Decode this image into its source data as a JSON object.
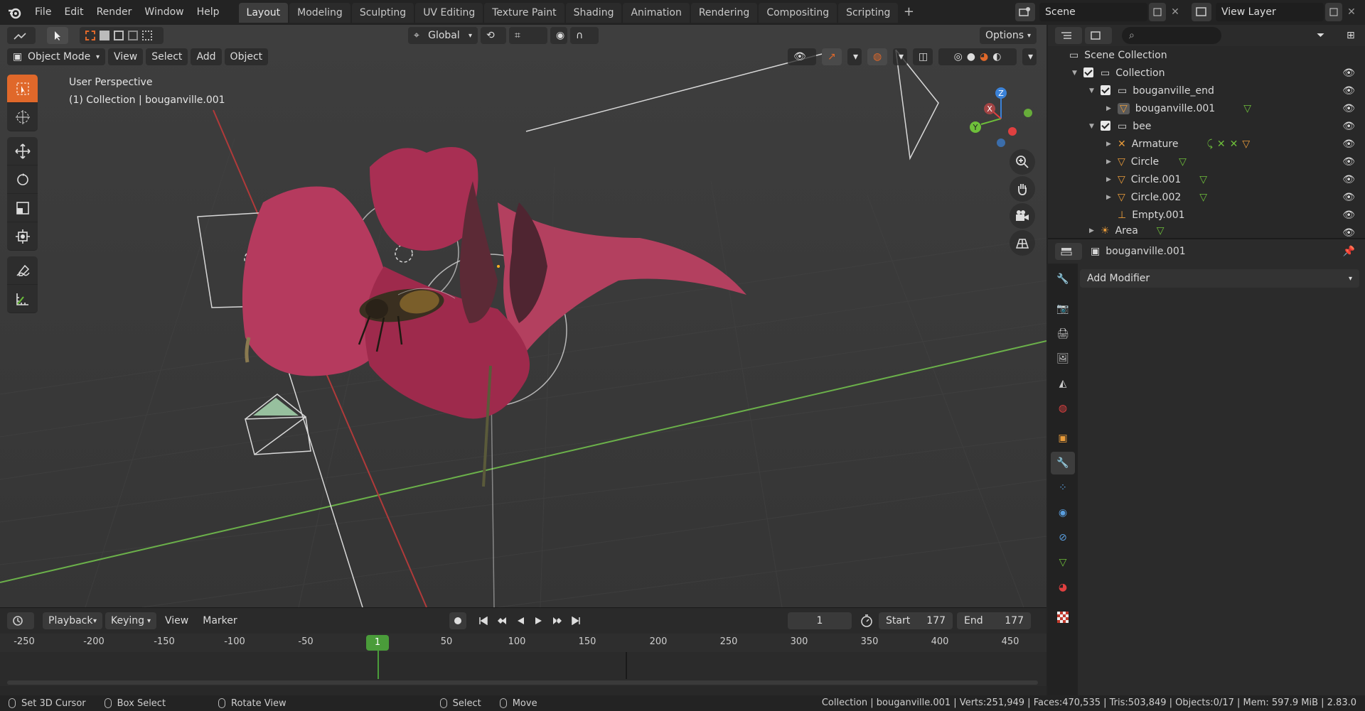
{
  "menu": [
    "File",
    "Edit",
    "Render",
    "Window",
    "Help"
  ],
  "workspaces": [
    "Layout",
    "Modeling",
    "Sculpting",
    "UV Editing",
    "Texture Paint",
    "Shading",
    "Animation",
    "Rendering",
    "Compositing",
    "Scripting"
  ],
  "active_workspace": "Layout",
  "scene_name": "Scene",
  "view_layer": "View Layer",
  "viewport": {
    "transform_orientation": "Global",
    "options_label": "Options",
    "mode": "Object Mode",
    "menus": [
      "View",
      "Select",
      "Add",
      "Object"
    ],
    "perspective_label": "User Perspective",
    "collection_label": "(1) Collection | bouganville.001",
    "gizmo_axes": {
      "x": "X",
      "y": "Y",
      "z": "Z"
    }
  },
  "timeline": {
    "menus": [
      "Playback",
      "Keying",
      "View",
      "Marker"
    ],
    "current_frame": "1",
    "start_label": "Start",
    "start": "177",
    "end_label": "End",
    "end": "177",
    "ticks": [
      "-250",
      "-200",
      "-150",
      "-100",
      "-50",
      "1",
      "50",
      "100",
      "150",
      "200",
      "250",
      "300",
      "350",
      "400",
      "450"
    ]
  },
  "outliner": {
    "rows": [
      {
        "label": "Scene Collection"
      },
      {
        "label": "Collection"
      },
      {
        "label": "bouganville_end"
      },
      {
        "label": "bouganville.001"
      },
      {
        "label": "bee"
      },
      {
        "label": "Armature"
      },
      {
        "label": "Circle"
      },
      {
        "label": "Circle.001"
      },
      {
        "label": "Circle.002"
      },
      {
        "label": "Empty.001"
      },
      {
        "label": "Area"
      }
    ]
  },
  "properties": {
    "object_name": "bouganville.001",
    "add_modifier": "Add Modifier"
  },
  "status": {
    "left": [
      "Set 3D Cursor",
      "Box Select",
      "Rotate View",
      "Select",
      "Move"
    ],
    "right": "Collection | bouganville.001 | Verts:251,949 | Faces:470,535 | Tris:503,849 | Objects:0/17 | Mem: 597.9 MiB | 2.83.0"
  },
  "colors": {
    "accent": "#e0682a",
    "selection": "#334d80",
    "frame": "#4a9c3a",
    "x_axis": "#e04040",
    "y_axis": "#6ebf3a",
    "z_axis": "#3b82d8"
  }
}
